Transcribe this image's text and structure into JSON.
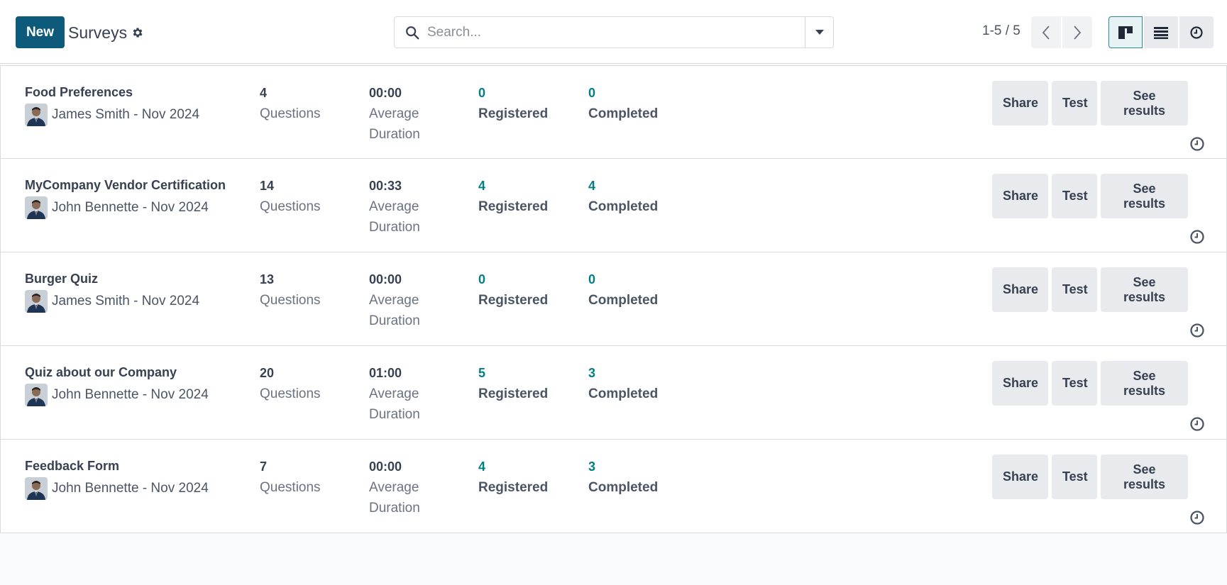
{
  "control_panel": {
    "new_label": "New",
    "breadcrumb": "Surveys",
    "search_placeholder": "Search...",
    "pager": "1-5 / 5"
  },
  "icons": {
    "gear": "gear-icon",
    "search": "search-icon",
    "toggle": "caret-down-icon",
    "prev": "chevron-left-icon",
    "next": "chevron-right-icon",
    "kanban": "kanban-view-icon",
    "list": "list-view-icon",
    "activity": "clock-icon"
  },
  "colors": {
    "primary": "#0d5a7a",
    "teal": "#017e84",
    "button_bg": "#e9eaed"
  },
  "labels": {
    "questions": "Questions",
    "average": "Average",
    "duration": "Duration",
    "registered": "Registered",
    "completed": "Completed",
    "share": "Share",
    "test": "Test",
    "see_results": "See results"
  },
  "surveys": [
    {
      "title": "Food Preferences",
      "author": "James Smith - Nov 2024",
      "questions": "4",
      "duration": "00:00",
      "registered": "0",
      "completed": "0"
    },
    {
      "title": "MyCompany Vendor Certification",
      "author": "John Bennette - Nov 2024",
      "questions": "14",
      "duration": "00:33",
      "registered": "4",
      "completed": "4"
    },
    {
      "title": "Burger Quiz",
      "author": "James Smith - Nov 2024",
      "questions": "13",
      "duration": "00:00",
      "registered": "0",
      "completed": "0"
    },
    {
      "title": "Quiz about our Company",
      "author": "John Bennette - Nov 2024",
      "questions": "20",
      "duration": "01:00",
      "registered": "5",
      "completed": "3"
    },
    {
      "title": "Feedback Form",
      "author": "John Bennette - Nov 2024",
      "questions": "7",
      "duration": "00:00",
      "registered": "4",
      "completed": "3"
    }
  ]
}
